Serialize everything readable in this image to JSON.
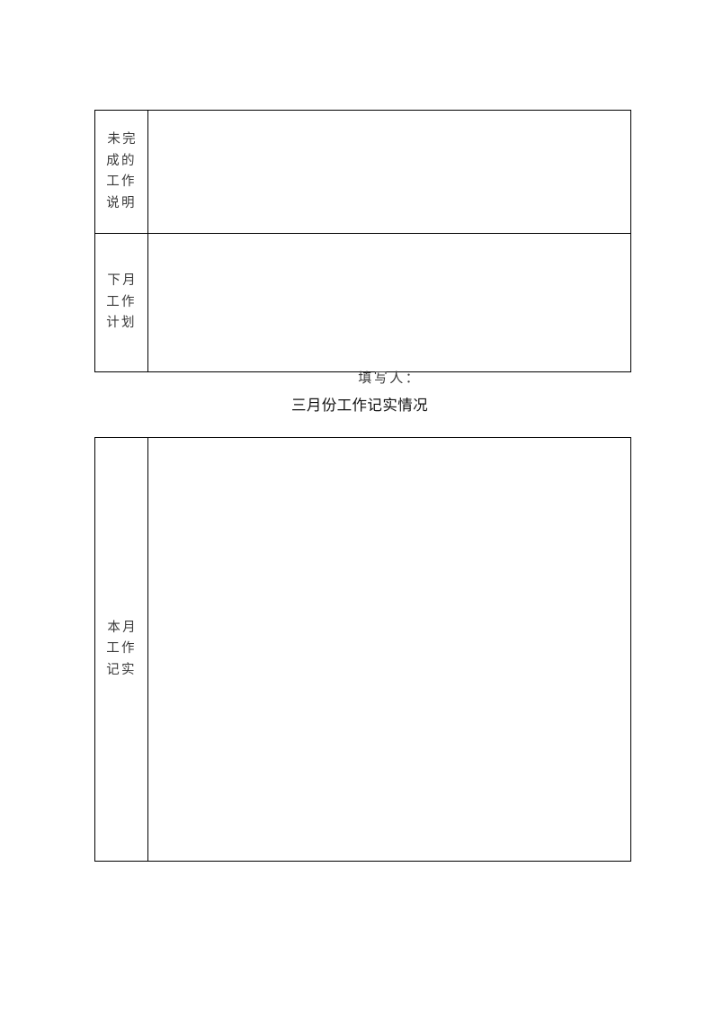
{
  "document": {
    "page_background": "#ffffff",
    "text_color_labels": "#3a3a3a",
    "text_color_title": "#111111",
    "border_color": "#000000"
  },
  "top_table": {
    "rows": [
      {
        "label": "未完\n成的\n工作\n说明",
        "label_plain": "未完成的工作说明",
        "entry_value": ""
      },
      {
        "label": "下月\n工作\n计划",
        "label_plain": "下月工作计划",
        "entry_value": ""
      }
    ]
  },
  "between": {
    "filled_by": "填写人：",
    "section_title": "三月份工作记实情况"
  },
  "bottom_table": {
    "rows": [
      {
        "label": "本月\n工作\n记实",
        "label_plain": "本月工作记实",
        "entry_value": ""
      }
    ]
  }
}
